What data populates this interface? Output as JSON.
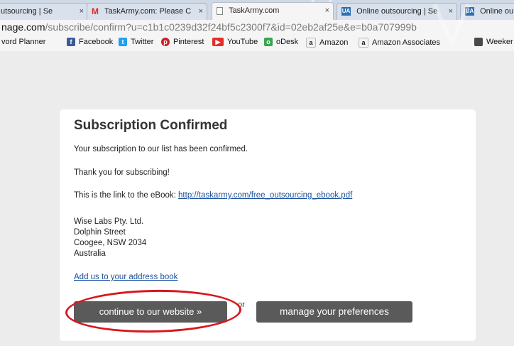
{
  "tabs": [
    {
      "title": "utsourcing | Se",
      "icon": "favicon-icon"
    },
    {
      "title": "TaskArmy.com: Please C",
      "icon": "gmail-icon"
    },
    {
      "title": "TaskArmy.com",
      "icon": "page-icon"
    },
    {
      "title": "Online outsourcing | Se",
      "icon": "upwork-icon"
    },
    {
      "title": "Online ou",
      "icon": "upwork-icon"
    }
  ],
  "tab_close": "×",
  "address": {
    "host": "nage.com",
    "path": "/subscribe/confirm?u=c1b1c0239d32f24bf5c2300f7&id=02eb2af25e&e=b0a707999b"
  },
  "bookmarks": [
    {
      "label": "vord Planner",
      "icon": ""
    },
    {
      "label": "Facebook",
      "icon": "facebook-icon",
      "color": "#3b5998"
    },
    {
      "label": "Twitter",
      "icon": "twitter-icon",
      "color": "#1da1f2"
    },
    {
      "label": "Pinterest",
      "icon": "pinterest-icon",
      "color": "#cb2027"
    },
    {
      "label": "YouTube",
      "icon": "youtube-icon",
      "color": "#e52d27"
    },
    {
      "label": "oDesk",
      "icon": "odesk-icon",
      "color": "#3aa552"
    },
    {
      "label": "Amazon",
      "icon": "amazon-icon",
      "color": "#222222"
    },
    {
      "label": "Amazon Associates",
      "icon": "amazon-icon",
      "color": "#222222"
    },
    {
      "label": "Weeker",
      "icon": "book-icon",
      "color": "#444444"
    }
  ],
  "card": {
    "title": "Subscription Confirmed",
    "confirmed_text": "Your subscription to our list has been confirmed.",
    "thanks_text": "Thank you for subscribing!",
    "ebook_prefix": "This is the link to the eBook: ",
    "ebook_link": "http://taskarmy.com/free_outsourcing_ebook.pdf",
    "address_lines": [
      "Wise Labs Pty. Ltd.",
      "Dolphin Street",
      "Coogee, NSW 2034",
      "Australia"
    ],
    "address_book_link": "Add us to your address book",
    "continue_button": "continue to our website »",
    "or_text": "or",
    "preferences_button": "manage your preferences"
  },
  "colors": {
    "button_bg": "#5a5a5a",
    "link": "#1a4f9c",
    "annotation": "#d9161d"
  }
}
